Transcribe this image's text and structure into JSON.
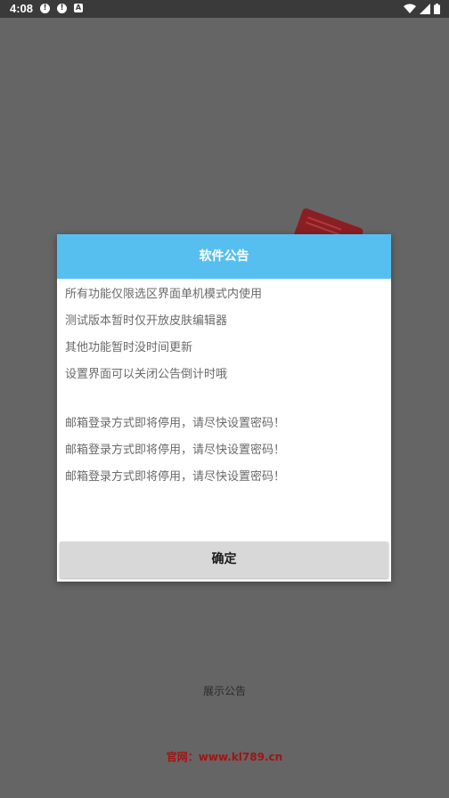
{
  "status_bar": {
    "time": "4:08",
    "icons_left": [
      "alert-icon",
      "alert-icon",
      "app-notification-icon"
    ],
    "icons_right": [
      "wifi-icon",
      "cellular-signal-icon",
      "battery-icon"
    ]
  },
  "dialog": {
    "title": "软件公告",
    "lines": [
      "所有功能仅限选区界面单机模式内使用",
      "测试版本暂时仅开放皮肤编辑器",
      "其他功能暂时没时间更新",
      "设置界面可以关闭公告倒计时哦",
      "",
      "邮箱登录方式即将停用，请尽快设置密码！",
      "邮箱登录方式即将停用，请尽快设置密码！",
      "邮箱登录方式即将停用，请尽快设置密码！"
    ],
    "confirm_label": "确定"
  },
  "show_notice_label": "展示公告",
  "website": "官网：www.kl789.cn",
  "colors": {
    "header": "#56bff0",
    "overlay": "#656565",
    "website": "#a01414"
  }
}
